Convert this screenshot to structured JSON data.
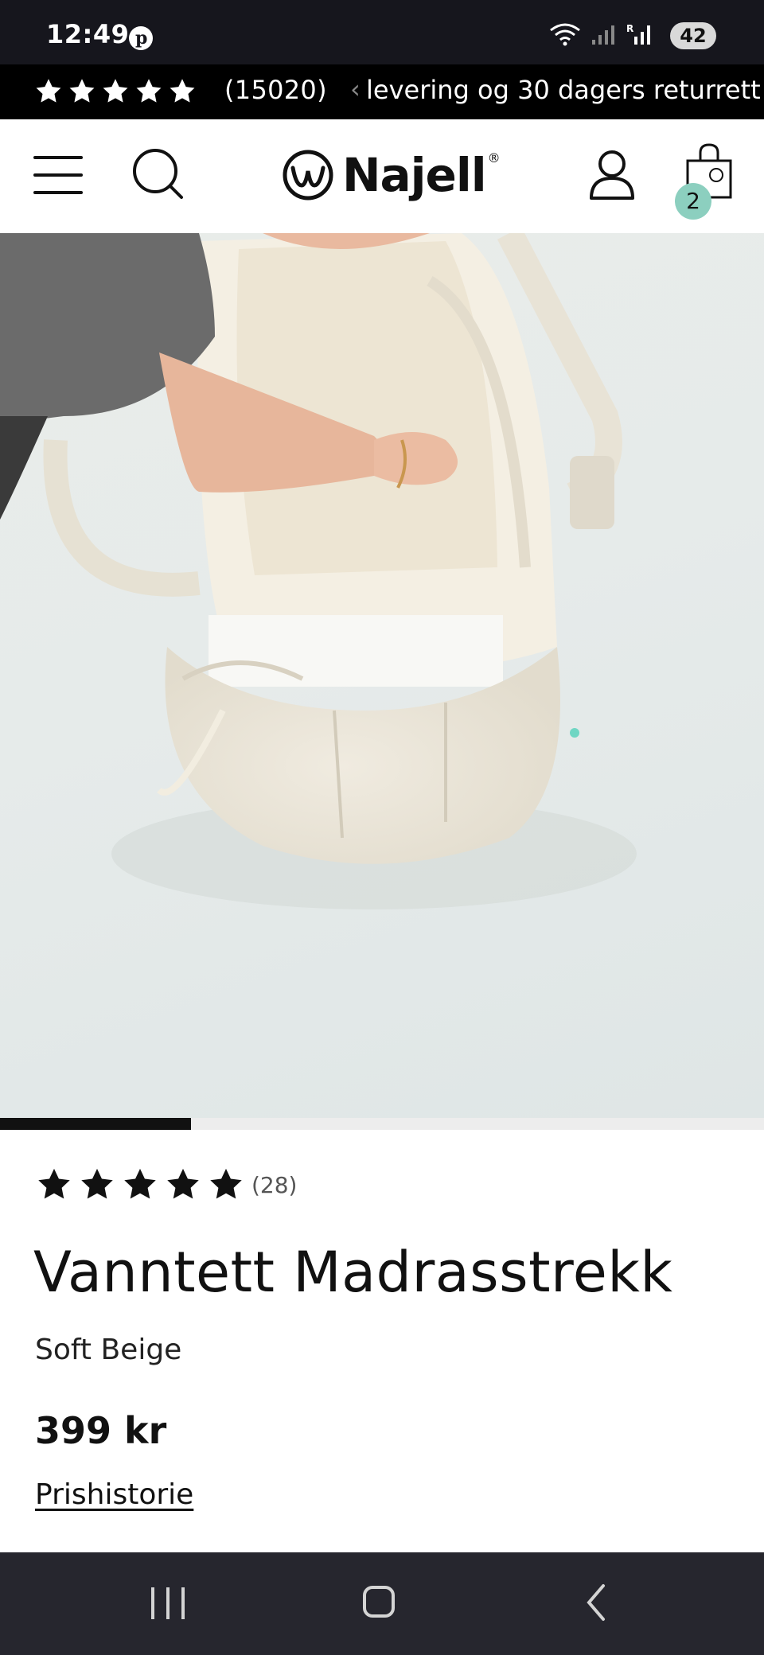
{
  "status_bar": {
    "time": "12:49",
    "pinterest_icon": "pinterest-icon",
    "network_label": "R",
    "battery": "42"
  },
  "promo_bar": {
    "stars": 5,
    "review_count": "(15020)",
    "message": "levering og 30 dagers returrett"
  },
  "header": {
    "brand": "Najell",
    "cart_count": "2",
    "icons": [
      "menu-icon",
      "search-icon",
      "account-icon",
      "cart-icon"
    ]
  },
  "gallery": {
    "progress": 0.25
  },
  "product": {
    "rating_stars": 5,
    "review_count": "(28)",
    "title": "Vanntett Madrasstrekk",
    "variant": "Soft Beige",
    "price": "399 kr",
    "price_history_link": "Prishistorie"
  },
  "colors": {
    "status_bar": "#16161d",
    "promo_bar": "#000000",
    "cart_badge": "#8ccfbf",
    "nav_bar": "#26262e"
  }
}
